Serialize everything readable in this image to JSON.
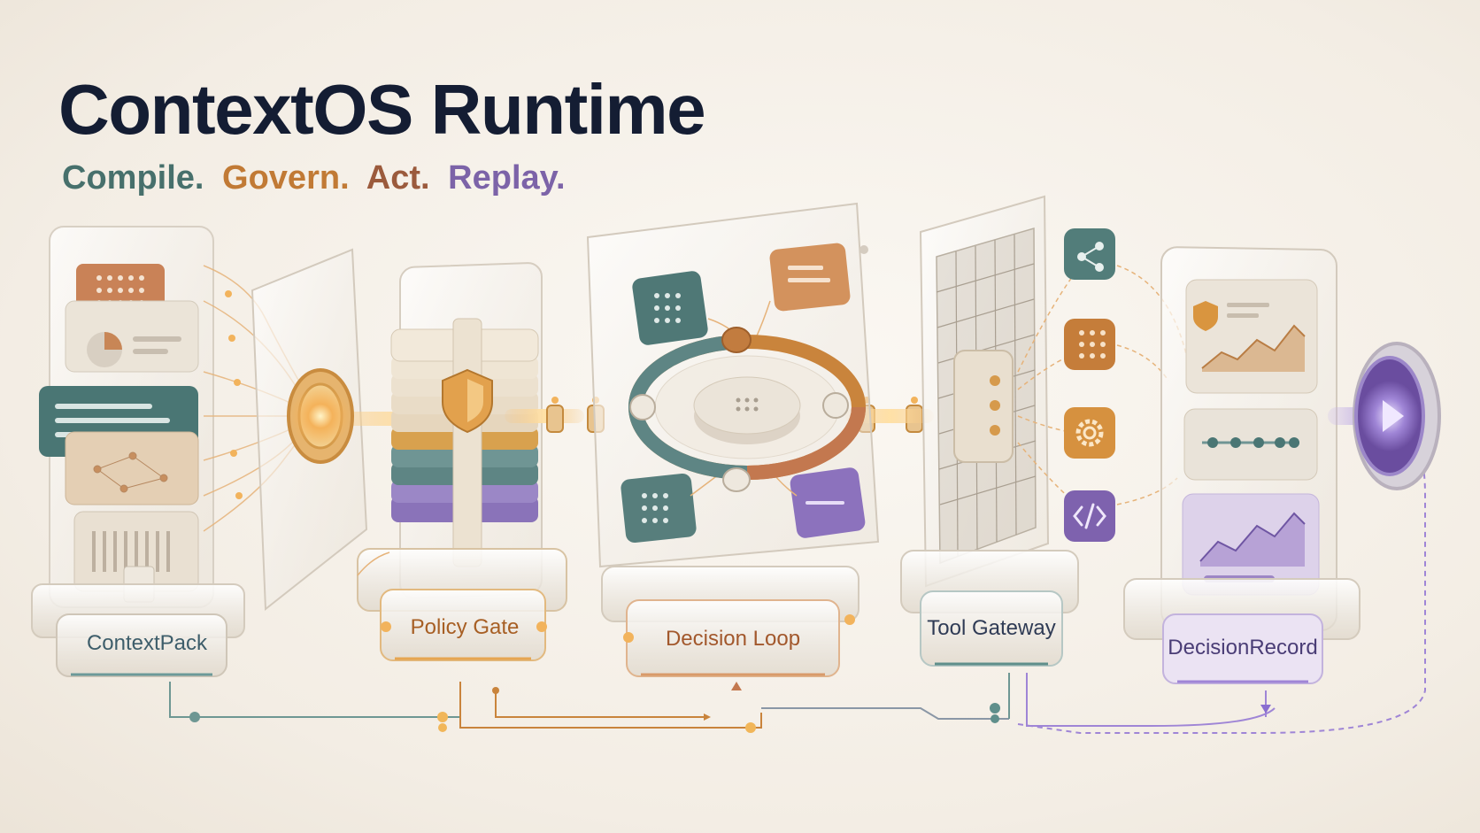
{
  "title": "ContextOS Runtime",
  "tagline": {
    "word1": "Compile.",
    "word2": "Govern.",
    "word3": "Act.",
    "word4": "Replay."
  },
  "stages": [
    {
      "label": "ContextPack"
    },
    {
      "label": "Policy Gate"
    },
    {
      "label": "Decision Loop"
    },
    {
      "label": "Tool Gateway"
    },
    {
      "label": "DecisionRecord"
    }
  ],
  "colors": {
    "teal": "#4a7674",
    "orange": "#c9843c",
    "terracotta": "#c3784f",
    "purple": "#7e68b0",
    "navy": "#141d33"
  },
  "icons": [
    "share-icon",
    "grid-icon",
    "gear-icon",
    "code-icon",
    "play-icon",
    "shield-icon"
  ]
}
